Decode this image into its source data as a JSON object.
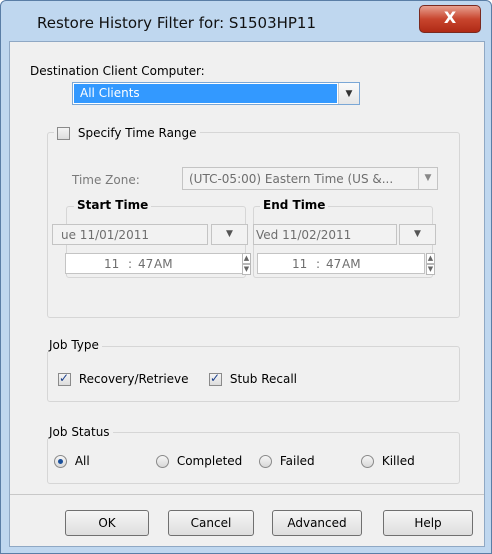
{
  "window": {
    "title": "Restore History Filter for: S1503HP11",
    "close_glyph": "X"
  },
  "destination": {
    "label": "Destination Client Computer:",
    "selected": "All Clients"
  },
  "time_range": {
    "checkbox_label": "Specify Time Range",
    "checked": false,
    "timezone_label": "Time Zone:",
    "timezone_value": "(UTC-05:00) Eastern Time (US &...",
    "start": {
      "legend": "Start Time",
      "date": "ue 11/01/2011",
      "hour": "11",
      "sep": ":",
      "minute": "47",
      "ampm": "AM"
    },
    "end": {
      "legend": "End Time",
      "date": "Ved 11/02/2011",
      "hour": "11",
      "sep": ":",
      "minute": "47",
      "ampm": "AM"
    }
  },
  "job_type": {
    "legend": "Job Type",
    "options": [
      {
        "label": "Recovery/Retrieve",
        "checked": true
      },
      {
        "label": "Stub Recall",
        "checked": true
      }
    ]
  },
  "job_status": {
    "legend": "Job Status",
    "options": [
      {
        "label": "All",
        "selected": true
      },
      {
        "label": "Completed",
        "selected": false
      },
      {
        "label": "Failed",
        "selected": false
      },
      {
        "label": "Killed",
        "selected": false
      }
    ]
  },
  "buttons": {
    "ok": "OK",
    "cancel": "Cancel",
    "advanced": "Advanced",
    "help": "Help"
  },
  "colors": {
    "selection": "#3399ff",
    "title_bar": "#bfd7ef",
    "close_button": "#c8452e"
  }
}
